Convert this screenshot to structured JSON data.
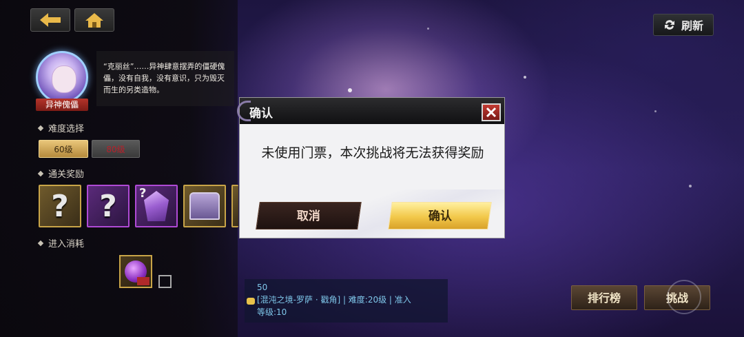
{
  "nav": {
    "back_icon": "back-arrow-icon",
    "home_icon": "home-icon",
    "refresh_label": "刷新"
  },
  "boss": {
    "name": "异神傀儡",
    "description": "“克丽丝”……异神肆意摆弄的僵硬傀儡，没有自我，没有意识，只为毁灭而生的另类造物。"
  },
  "difficulty": {
    "label": "难度选择",
    "options": [
      "60级",
      "80级"
    ],
    "selected": "60级"
  },
  "rewards": {
    "label": "通关奖励",
    "items": [
      "unknown-reward",
      "unknown-reward",
      "crystal",
      "chest"
    ],
    "item_mark": "?"
  },
  "cost": {
    "label": "进入消耗"
  },
  "chat": {
    "line1": "50",
    "line2": "[混沌之境-罗萨 · 戳角] | 难度:20级 | 准入",
    "line3": "等级:10"
  },
  "actions": {
    "ranking_label": "排行榜",
    "challenge_label": "挑战"
  },
  "dialog": {
    "title": "确认",
    "message": "未使用门票，本次挑战将无法获得奖励",
    "cancel_label": "取消",
    "confirm_label": "确认"
  },
  "colors": {
    "accent_gold": "#f2c84a",
    "close_red": "#c23a32",
    "chat_text": "#7fc7ea"
  }
}
